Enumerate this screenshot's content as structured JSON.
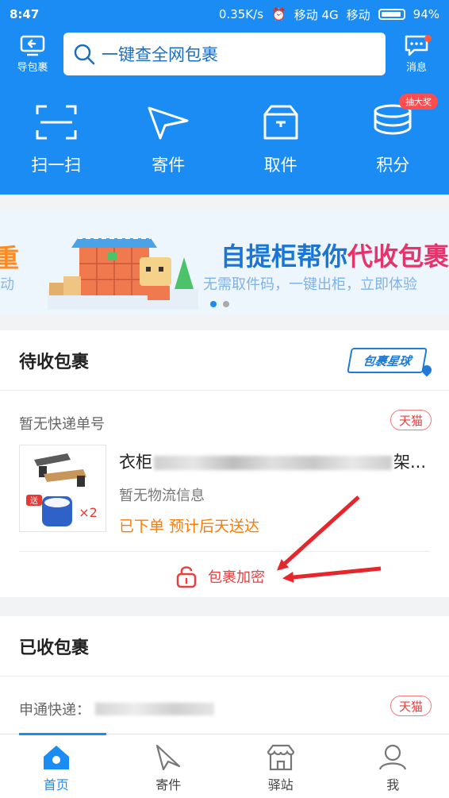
{
  "status_bar": {
    "time": "8:47",
    "speed": "0.35K/s",
    "carrier1": "移动 4G",
    "carrier2": "移动",
    "battery": "94%"
  },
  "header": {
    "import_label": "导包裹",
    "search_placeholder": "一键查全网包裹",
    "message_label": "消息"
  },
  "quick_actions": {
    "items": [
      {
        "label": "扫一扫",
        "icon": "scan-icon"
      },
      {
        "label": "寄件",
        "icon": "send-plane-icon"
      },
      {
        "label": "取件",
        "icon": "box-icon"
      },
      {
        "label": "积分",
        "icon": "coins-icon"
      }
    ],
    "badge": "抽大奖"
  },
  "banner": {
    "peek_left": "重",
    "peek_left_sub": "动",
    "title_part1": "自提柜帮你",
    "title_highlight": "代收包裹",
    "subtitle": "无需取件码，一键出柜，立即体验"
  },
  "pending": {
    "title": "待收包裹",
    "logo_text": "包裹星球",
    "no_tracking": "暂无快递单号",
    "shop_tag": "天猫",
    "goods_name_prefix": "衣柜",
    "goods_name_suffix": "架...",
    "goods_status": "暂无物流信息",
    "goods_eta": "已下单  预计后天送达",
    "thumb_qty": "×2",
    "thumb_gift": "送",
    "encrypt_label": "包裹加密"
  },
  "received": {
    "title": "已收包裹",
    "courier": "申通快递：",
    "shop_tag": "天猫"
  },
  "tabbar": {
    "items": [
      {
        "label": "首页"
      },
      {
        "label": "寄件"
      },
      {
        "label": "驿站"
      },
      {
        "label": "我"
      }
    ]
  },
  "colors": {
    "brand": "#1a8cf3",
    "accent_red": "#e84040",
    "orange": "#ff7a00"
  }
}
